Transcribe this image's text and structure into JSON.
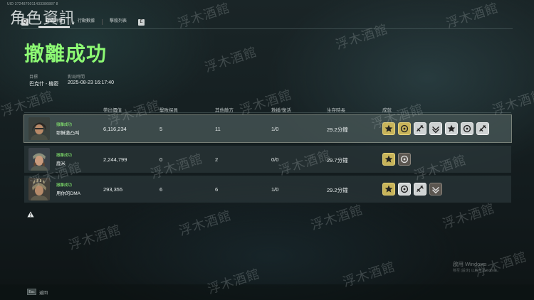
{
  "header": {
    "uid": "UID 3724870011433386887 8",
    "brand_text": "角色資訊"
  },
  "tabs": [
    {
      "label": "戰績詳情",
      "active": true
    },
    {
      "label": "行動數據",
      "active": false
    },
    {
      "label": "擊殺列表",
      "active": false
    }
  ],
  "tab_back_glyph": "Q",
  "tab_next_key": "E",
  "result_title": "撤離成功",
  "meta": {
    "target_label": "目標",
    "target_value": "巴克什 - 機密",
    "time_label": "對局時間",
    "time_value": "2025-08-23 16:17:40"
  },
  "columns": [
    "帶出價值",
    "擊敗探員",
    "其他敵方",
    "救援/復活",
    "生存時長",
    "成就"
  ],
  "rows": [
    {
      "status": "撤離成功",
      "name": "耶穌激凸叫",
      "value": "6,116,234",
      "kills": "5",
      "other_enemies": "11",
      "revive": "1/0",
      "survival": "29.2分鐘",
      "highlight": true,
      "medals": [
        "gold",
        "gold",
        "silver",
        "silver",
        "silver",
        "silver",
        "silver"
      ]
    },
    {
      "status": "撤離成功",
      "name": "鹿米",
      "value": "2,244,799",
      "kills": "0",
      "other_enemies": "2",
      "revive": "0/0",
      "survival": "29.7分鐘",
      "highlight": false,
      "medals": [
        "gold",
        "bronze"
      ]
    },
    {
      "status": "撤離成功",
      "name": "用你的DMA",
      "value": "293,355",
      "kills": "6",
      "other_enemies": "6",
      "revive": "1/0",
      "survival": "29.2分鐘",
      "highlight": false,
      "medals": [
        "gold",
        "silver",
        "silver",
        "bronze"
      ]
    }
  ],
  "windows_activation": {
    "title": "啟用 Windows",
    "subtitle": "移至 [設定] 以啟用 Windows。"
  },
  "footer": {
    "key": "Esc",
    "label": "返回"
  },
  "watermark_text": "浮木酒館",
  "colors": {
    "accent_green": "#8dfa74",
    "medal_gold": "#c8b45a",
    "medal_silver": "#cfd3d3",
    "medal_bronze": "#5b5650"
  }
}
